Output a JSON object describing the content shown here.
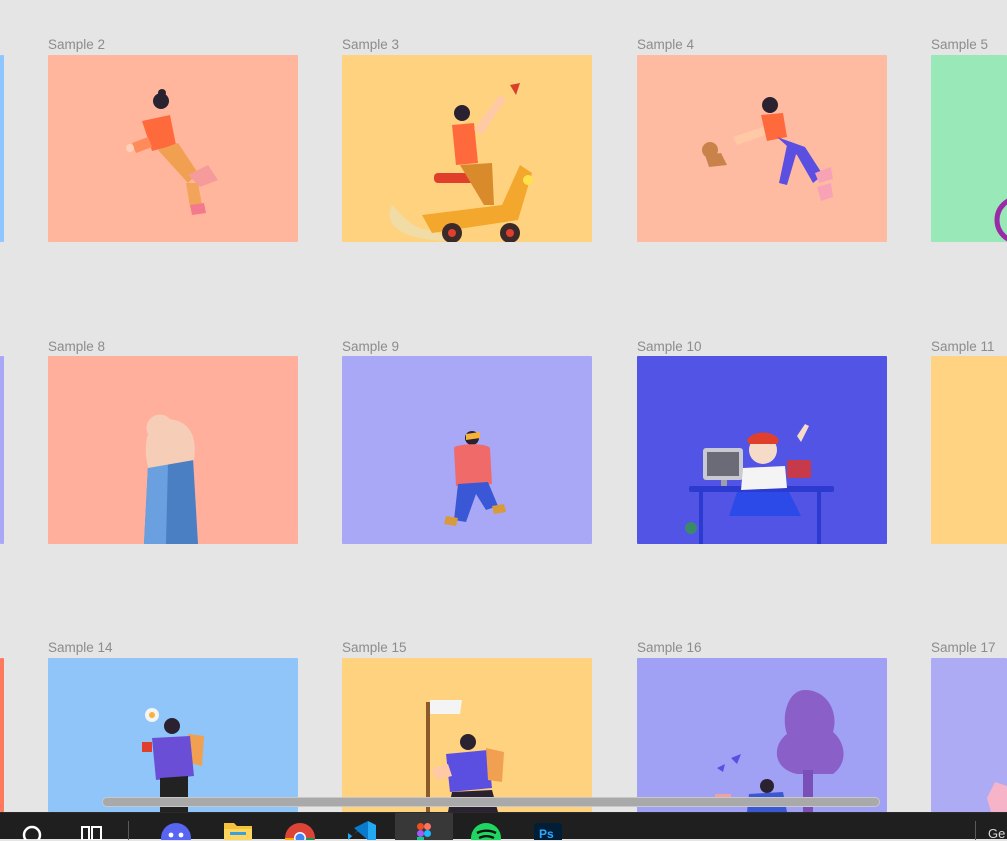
{
  "frames": [
    {
      "label": "Sample 2",
      "bg": "#ffb69d"
    },
    {
      "label": "Sample 3",
      "bg": "#ffd27f"
    },
    {
      "label": "Sample 4",
      "bg": "#ffbba1"
    },
    {
      "label": "Sample 5",
      "bg": "#98e8b8"
    },
    {
      "label": "Sample 8",
      "bg": "#ffaf9c"
    },
    {
      "label": "Sample 9",
      "bg": "#a8a8f6"
    },
    {
      "label": "Sample 10",
      "bg": "#5254e6"
    },
    {
      "label": "Sample 11",
      "bg": "#ffd382"
    },
    {
      "label": "Sample 14",
      "bg": "#90c5fa"
    },
    {
      "label": "Sample 15",
      "bg": "#ffd27f"
    },
    {
      "label": "Sample 16",
      "bg": "#a0a0f5"
    },
    {
      "label": "Sample 17",
      "bg": "#acabf3"
    }
  ],
  "partial_left_frames": [
    "#8ec6ff",
    "#a8a8f6",
    "#ff7a5c"
  ],
  "taskbar": {
    "apps": [
      "search-icon",
      "task-view-icon",
      "discord-icon",
      "file-explorer-icon",
      "chrome-icon",
      "vscode-icon",
      "figma-icon",
      "spotify-icon",
      "photoshop-icon"
    ],
    "clipped_text": "Ge"
  }
}
